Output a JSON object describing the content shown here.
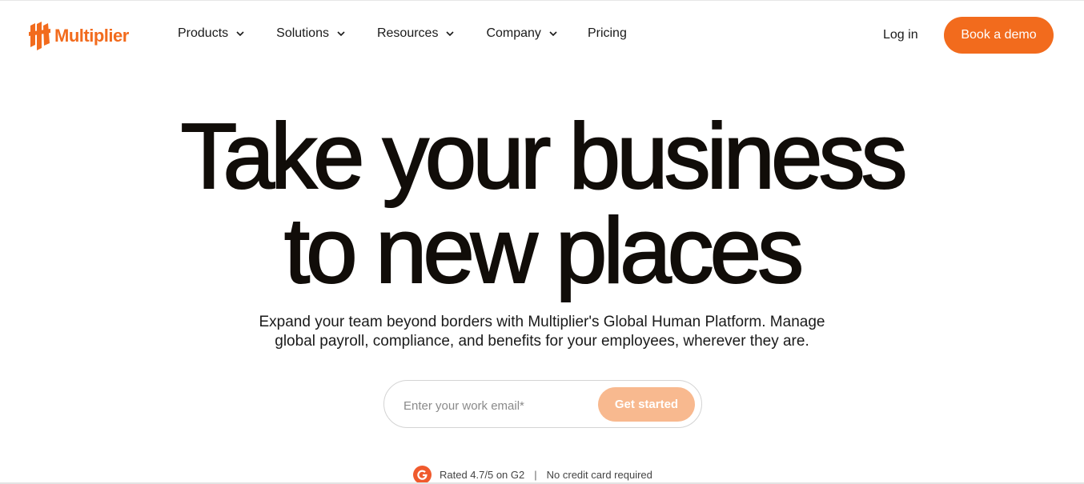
{
  "brand": {
    "name": "Multiplier",
    "color": "#f26b1d"
  },
  "nav": {
    "items": [
      {
        "label": "Products",
        "icon": "chevron-down-icon"
      },
      {
        "label": "Solutions",
        "icon": "chevron-down-icon"
      },
      {
        "label": "Resources",
        "icon": "chevron-down-icon"
      },
      {
        "label": "Company",
        "icon": "chevron-down-icon"
      },
      {
        "label": "Pricing"
      }
    ],
    "login_label": "Log in",
    "demo_label": "Book a demo"
  },
  "hero": {
    "headline_line1": "Take your business",
    "headline_line2": "to new places",
    "subtext_line1": "Expand your team beyond borders with Multiplier's Global Human Platform. Manage",
    "subtext_line2": "global payroll, compliance, and benefits for your employees, wherever they are.",
    "email_placeholder": "Enter your work email*",
    "cta_label": "Get started",
    "cta_color": "#f8b98f"
  },
  "trust": {
    "g2_icon": "g2-logo-icon",
    "rating_text": "Rated 4.7/5 on G2",
    "separator": "|",
    "no_card_text": "No credit card required"
  }
}
